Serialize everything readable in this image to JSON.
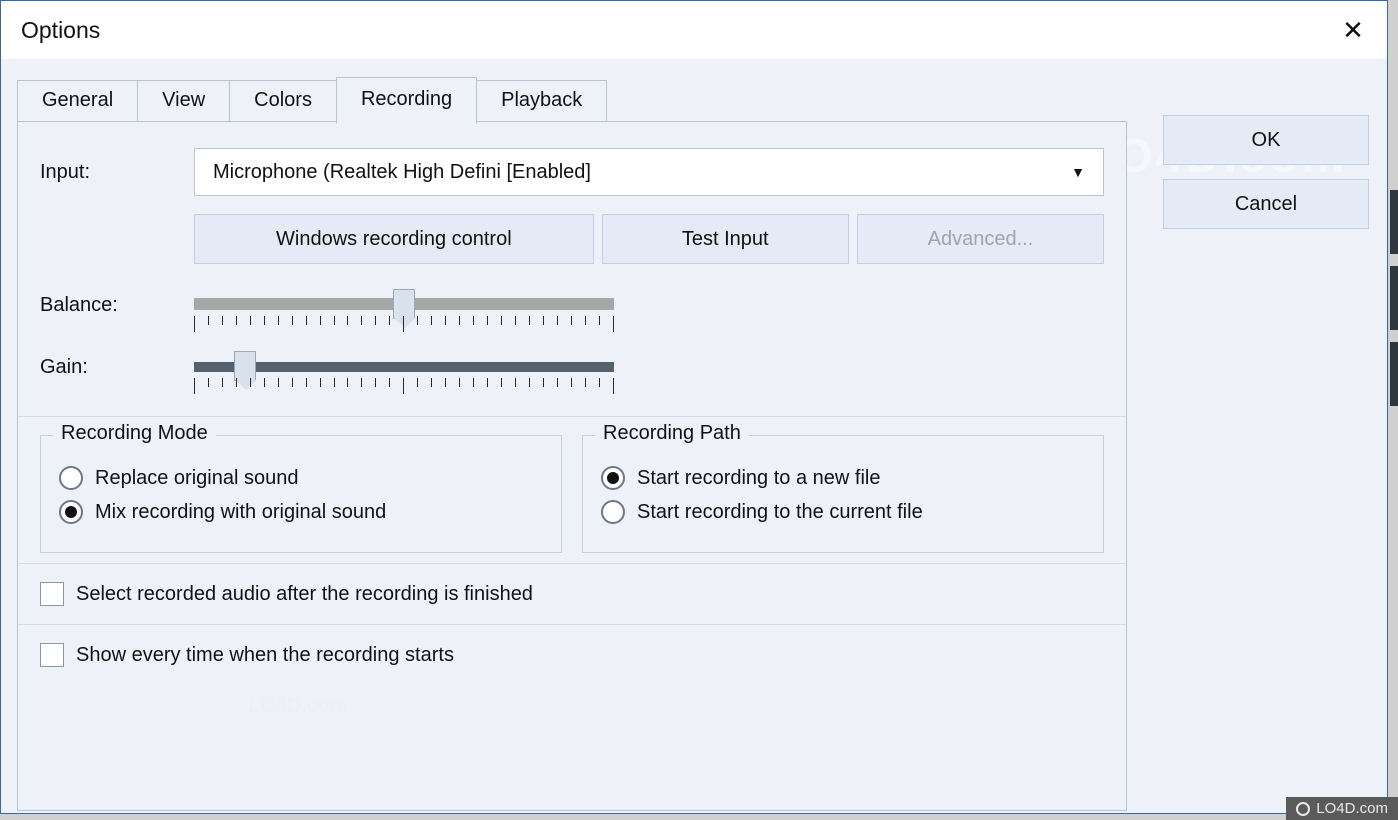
{
  "window": {
    "title": "Options"
  },
  "tabs": {
    "general": "General",
    "view": "View",
    "colors": "Colors",
    "recording": "Recording",
    "playback": "Playback"
  },
  "buttons": {
    "ok": "OK",
    "cancel": "Cancel",
    "wrc": "Windows recording control",
    "test": "Test Input",
    "advanced": "Advanced..."
  },
  "labels": {
    "input": "Input:",
    "balance": "Balance:",
    "gain": "Gain:"
  },
  "input_selected": "Microphone (Realtek High Defini [Enabled]",
  "balance_percent": 50,
  "gain_percent": 10,
  "groups": {
    "mode_title": "Recording Mode",
    "path_title": "Recording Path",
    "mode": {
      "replace": "Replace original sound",
      "mix": "Mix recording with original sound",
      "selected": "mix"
    },
    "path": {
      "newfile": "Start recording to a new file",
      "current": "Start recording to the current file",
      "selected": "newfile"
    }
  },
  "checks": {
    "select_after": "Select recorded audio after the recording is finished",
    "show_every": "Show every time when the recording starts"
  },
  "watermark": "LO4D.com",
  "badge": "LO4D.com"
}
